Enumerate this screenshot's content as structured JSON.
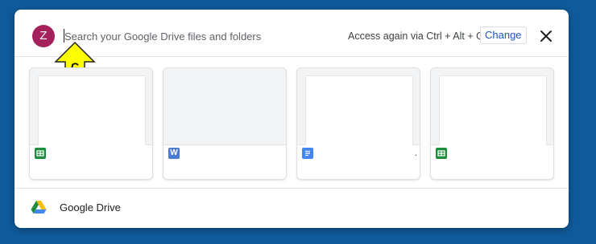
{
  "header": {
    "avatar_letter": "Z",
    "search_placeholder": "Search your Google Drive files and folders",
    "access_hint": "Access again via Ctrl + Alt + G",
    "change_label": "Change",
    "close_icon": "close-icon"
  },
  "cursor": {
    "letter": "C",
    "color": "#ffff00"
  },
  "files": [
    {
      "type": "sheets",
      "icon_color": "#1e8e3e",
      "icon_glyph": "+",
      "name": ""
    },
    {
      "type": "word",
      "icon_color": "#4a7bd0",
      "icon_glyph": "W",
      "name": ""
    },
    {
      "type": "docs",
      "icon_color": "#4285f4",
      "icon_glyph": "≡",
      "name": "."
    },
    {
      "type": "sheets",
      "icon_color": "#1e8e3e",
      "icon_glyph": "+",
      "name": ""
    }
  ],
  "footer": {
    "label": "Google Drive"
  },
  "colors": {
    "background": "#0f5a9a",
    "avatar": "#a5215b",
    "change_text": "#1a56c4"
  }
}
